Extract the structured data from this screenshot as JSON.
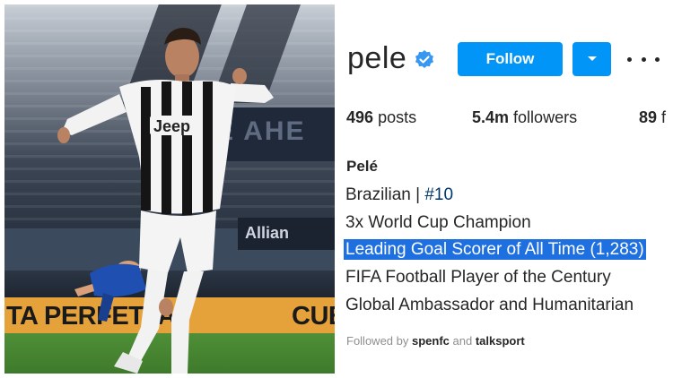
{
  "photo": {
    "jersey_text": "Jeep",
    "perimeter_board": "TA PERFETTA",
    "perimeter_board_right": "CUE",
    "stand_banner": "E AHE",
    "ad_board": "Allian"
  },
  "profile": {
    "username": "pele",
    "follow_label": "Follow",
    "posts_count": "496",
    "posts_label": "posts",
    "followers_count": "5.4m",
    "followers_label": "followers",
    "following_count": "89",
    "following_label": "f",
    "full_name": "Pelé",
    "bio": {
      "line1_text": "Brazilian | ",
      "line1_hashtag": "#10",
      "line2": "3x World Cup Champion",
      "line3": "Leading Goal Scorer of All Time (1,283)",
      "line4": "FIFA Football Player of the Century",
      "line5": "Global Ambassador and Humanitarian"
    },
    "followed_by_prefix": "Followed by ",
    "followed_by_1": "spenfc",
    "followed_by_and": " and ",
    "followed_by_2": "talksport"
  },
  "colors": {
    "accent": "#0095f6",
    "highlight": "#1e6fe0",
    "hashtag": "#00376b",
    "text": "#262626",
    "muted": "#8e8e8e"
  },
  "icons": [
    "verified-badge-icon",
    "chevron-down-icon",
    "more-options-icon"
  ]
}
